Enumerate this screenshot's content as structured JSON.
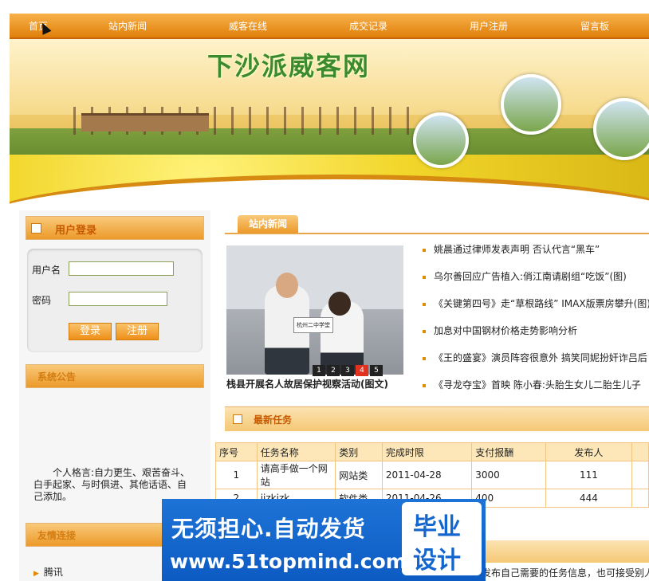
{
  "nav": {
    "items": [
      {
        "label": "首页"
      },
      {
        "label": "站内新闻"
      },
      {
        "label": "威客在线"
      },
      {
        "label": "成交记录"
      },
      {
        "label": "用户注册"
      },
      {
        "label": "留言板"
      }
    ]
  },
  "banner": {
    "title": "下沙派威客网"
  },
  "login": {
    "heading": "用户登录",
    "username_label": "用户名",
    "password_label": "密码",
    "login_button": "登录",
    "register_button": "注册"
  },
  "notice": {
    "heading": "系统公告",
    "motto": "个人格言:自力更生、艰苦奋斗、白手起家、与时俱进、其他话语、自己添加。"
  },
  "links": {
    "heading": "友情连接",
    "items": [
      {
        "label": "腾讯"
      }
    ]
  },
  "news": {
    "tab_label": "站内新闻",
    "slide_caption": "栈县开展名人故居保护视察活动(图文)",
    "slide_sign": "杭州二中学堂",
    "pager": [
      "1",
      "2",
      "3",
      "4",
      "5"
    ],
    "active_page": "4",
    "items": [
      {
        "title": "姚晨通过律师发表声明 否认代言“黑车”"
      },
      {
        "title": "乌尔善回应广告植入:俏江南请剧组“吃饭”(图)"
      },
      {
        "title": "《关键第四号》走“草根路线” IMAX版票房攀升(图)"
      },
      {
        "title": "加息对中国钢材价格走势影响分析"
      },
      {
        "title": "《王的盛宴》演员阵容很意外 搞笑同妮扮奸诈吕后"
      },
      {
        "title": "《寻龙夺宝》首映 陈小春:头胎生女儿二胎生儿子"
      }
    ]
  },
  "tasks": {
    "heading": "最新任务",
    "columns": [
      "序号",
      "任务名称",
      "类别",
      "完成时限",
      "支付报酬",
      "发布人"
    ],
    "rows": [
      [
        "1",
        "请高手做一个网站",
        "网站类",
        "2011-04-28",
        "3000",
        "111"
      ],
      [
        "2",
        "jjzkjzk",
        "软件类",
        "2011-04-26",
        "400",
        "444"
      ]
    ]
  },
  "bottom": {
    "text": "发布自己需要的任务信息，也可接受别人"
  },
  "watermark": {
    "line1": "无须担心.自动发货",
    "line2": "www.51topmind.com",
    "badge_line1": "毕业",
    "badge_line2": "设计"
  }
}
